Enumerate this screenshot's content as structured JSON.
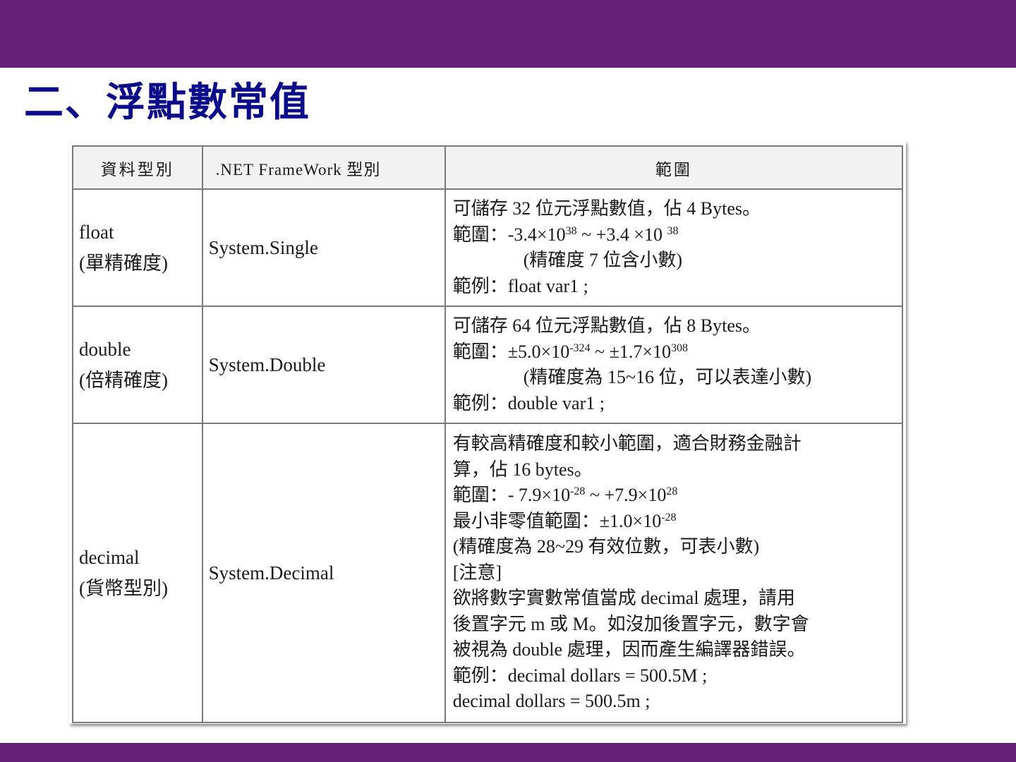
{
  "slide": {
    "title": "二、浮點數常值"
  },
  "table": {
    "headers": [
      "資料型別",
      ".NET FrameWork 型別",
      "範圍"
    ],
    "rows": [
      {
        "type_name": "float",
        "type_desc": "(單精確度)",
        "framework_type": "System.Single",
        "range": {
          "l1": "可儲存 32 位元浮點數值，佔 4 Bytes。",
          "l2_a": "範圍：-3.4×10",
          "l2_sup1": "38",
          "l2_b": " ~ +3.4 ×10 ",
          "l2_sup2": "38",
          "l3": "(精確度 7 位含小數)",
          "l4": "範例：float var1 ;"
        }
      },
      {
        "type_name": "double",
        "type_desc": "(倍精確度)",
        "framework_type": "System.Double",
        "range": {
          "l1": "可儲存 64 位元浮點數值，佔 8 Bytes。",
          "l2_a": "範圍：±5.0×10",
          "l2_sup1": "-324",
          "l2_b": " ~ ±1.7×10",
          "l2_sup2": "308",
          "l3": "(精確度為 15~16 位，可以表達小數)",
          "l4": "範例：double var1 ;"
        }
      },
      {
        "type_name": "decimal",
        "type_desc": "(貨幣型別)",
        "framework_type": "System.Decimal",
        "range": {
          "l1": "有較高精確度和較小範圍，適合財務金融計",
          "l2": "算，佔 16 bytes。",
          "l3_a": "範圍：- 7.9×10",
          "l3_sup1": "-28",
          "l3_b": "  ~ +7.9×10",
          "l3_sup2": "28",
          "l4_a": "最小非零值範圍：±1.0×10",
          "l4_sup": "-28",
          "l5": "(精確度為 28~29  有效位數，可表小數)",
          "l6": "[注意]",
          "l7": "欲將數字實數常值當成  decimal  處理，請用",
          "l8": "後置字元 m 或 M。如沒加後置字元，數字會",
          "l9": "被視為 double 處理，因而產生編譯器錯誤。",
          "l10": "範例：decimal dollars = 500.5M ;",
          "l11": "decimal dollars = 500.5m ;"
        }
      }
    ]
  },
  "colors": {
    "bar": "#652175",
    "title": "#0b0c8a"
  }
}
